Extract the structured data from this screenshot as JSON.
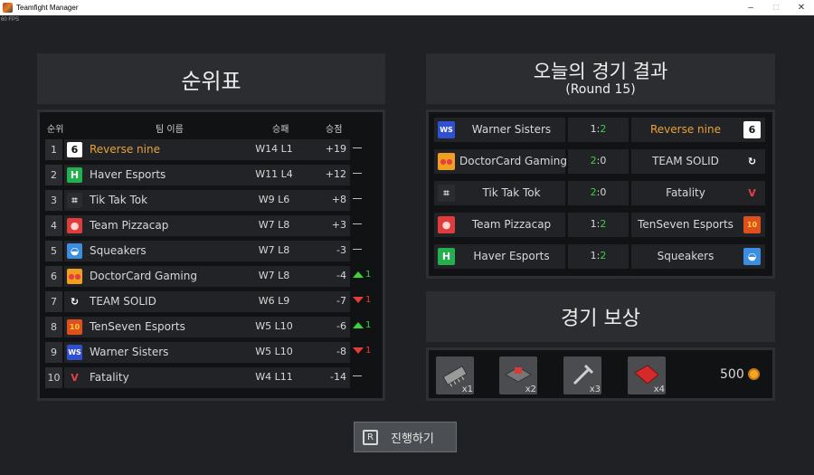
{
  "window": {
    "title": "Teamfight Manager",
    "fps": "60 FPS",
    "minimize": "–",
    "maximize": "□",
    "close": "✕"
  },
  "standings": {
    "title": "순위표",
    "columns": {
      "rank": "순위",
      "team": "팀 이름",
      "record": "승패",
      "points": "승점"
    },
    "rows": [
      {
        "rank": "1",
        "name": "Reverse nine",
        "record": "W14 L1",
        "points": "+19",
        "change": "",
        "dir": "none",
        "highlight": true,
        "logo": "reverse-nine-logo",
        "logo_text": "6",
        "logo_bg": "#ffffff",
        "logo_fg": "#111111"
      },
      {
        "rank": "2",
        "name": "Haver Esports",
        "record": "W11 L4",
        "points": "+12",
        "change": "",
        "dir": "none",
        "highlight": false,
        "logo": "haver-esports-logo",
        "logo_text": "H",
        "logo_bg": "#22b14c",
        "logo_fg": "#ffffff"
      },
      {
        "rank": "3",
        "name": "Tik Tak Tok",
        "record": "W9 L6",
        "points": "+8",
        "change": "",
        "dir": "none",
        "highlight": false,
        "logo": "tik-tak-tok-logo",
        "logo_text": "⌗",
        "logo_bg": "#2a2c2f",
        "logo_fg": "#dddddd"
      },
      {
        "rank": "4",
        "name": "Team Pizzacap",
        "record": "W7 L8",
        "points": "+3",
        "change": "",
        "dir": "none",
        "highlight": false,
        "logo": "team-pizzacap-logo",
        "logo_text": "●",
        "logo_bg": "#e03c3c",
        "logo_fg": "#ffd6d6"
      },
      {
        "rank": "5",
        "name": "Squeakers",
        "record": "W7 L8",
        "points": "-3",
        "change": "",
        "dir": "none",
        "highlight": false,
        "logo": "squeakers-logo",
        "logo_text": "◒",
        "logo_bg": "#3c8fe0",
        "logo_fg": "#ffffff"
      },
      {
        "rank": "6",
        "name": "DoctorCard Gaming",
        "record": "W7 L8",
        "points": "-4",
        "change": "1",
        "dir": "up",
        "highlight": false,
        "logo": "doctorcard-gaming-logo",
        "logo_text": "●●",
        "logo_bg": "#f0a020",
        "logo_fg": "#e84040"
      },
      {
        "rank": "7",
        "name": "TEAM SOLID",
        "record": "W6 L9",
        "points": "-7",
        "change": "1",
        "dir": "down",
        "highlight": false,
        "logo": "team-solid-logo",
        "logo_text": "↻",
        "logo_bg": "#222326",
        "logo_fg": "#ffffff"
      },
      {
        "rank": "8",
        "name": "TenSeven Esports",
        "record": "W5 L10",
        "points": "-6",
        "change": "1",
        "dir": "up",
        "highlight": false,
        "logo": "tenseven-esports-logo",
        "logo_text": "10",
        "logo_bg": "#e0501c",
        "logo_fg": "#ffd040"
      },
      {
        "rank": "9",
        "name": "Warner Sisters",
        "record": "W5 L10",
        "points": "-8",
        "change": "1",
        "dir": "down",
        "highlight": false,
        "logo": "warner-sisters-logo",
        "logo_text": "WS",
        "logo_bg": "#3050d0",
        "logo_fg": "#ffffff"
      },
      {
        "rank": "10",
        "name": "Fatality",
        "record": "W4 L11",
        "points": "-14",
        "change": "",
        "dir": "none",
        "highlight": false,
        "logo": "fatality-logo",
        "logo_text": "V",
        "logo_bg": "#222326",
        "logo_fg": "#e84040"
      }
    ]
  },
  "results": {
    "title": "오늘의 경기 결과",
    "subtitle": "(Round 15)",
    "matches": [
      {
        "left": "Warner Sisters",
        "left_score": "1",
        "right_score": "2",
        "right": "Reverse nine",
        "winner": "right",
        "left_logo": "warner-sisters-logo",
        "left_logo_text": "WS",
        "left_logo_bg": "#3050d0",
        "left_logo_fg": "#ffffff",
        "right_logo": "reverse-nine-logo",
        "right_logo_text": "6",
        "right_logo_bg": "#ffffff",
        "right_logo_fg": "#111111"
      },
      {
        "left": "DoctorCard Gaming",
        "left_score": "2",
        "right_score": "0",
        "right": "TEAM SOLID",
        "winner": "left",
        "left_logo": "doctorcard-gaming-logo",
        "left_logo_text": "●●",
        "left_logo_bg": "#f0a020",
        "left_logo_fg": "#e84040",
        "right_logo": "team-solid-logo",
        "right_logo_text": "↻",
        "right_logo_bg": "#222326",
        "right_logo_fg": "#ffffff"
      },
      {
        "left": "Tik Tak Tok",
        "left_score": "2",
        "right_score": "0",
        "right": "Fatality",
        "winner": "left",
        "left_logo": "tik-tak-tok-logo",
        "left_logo_text": "⌗",
        "left_logo_bg": "#2a2c2f",
        "left_logo_fg": "#dddddd",
        "right_logo": "fatality-logo",
        "right_logo_text": "V",
        "right_logo_bg": "#222326",
        "right_logo_fg": "#e84040"
      },
      {
        "left": "Team Pizzacap",
        "left_score": "1",
        "right_score": "2",
        "right": "TenSeven Esports",
        "winner": "right",
        "left_logo": "team-pizzacap-logo",
        "left_logo_text": "●",
        "left_logo_bg": "#e03c3c",
        "left_logo_fg": "#ffd6d6",
        "right_logo": "tenseven-esports-logo",
        "right_logo_text": "10",
        "right_logo_bg": "#e0501c",
        "right_logo_fg": "#ffd040"
      },
      {
        "left": "Haver Esports",
        "left_score": "1",
        "right_score": "2",
        "right": "Squeakers",
        "winner": "right",
        "left_logo": "haver-esports-logo",
        "left_logo_text": "H",
        "left_logo_bg": "#22b14c",
        "left_logo_fg": "#ffffff",
        "right_logo": "squeakers-logo",
        "right_logo_text": "◒",
        "right_logo_bg": "#3c8fe0",
        "right_logo_fg": "#ffffff"
      }
    ]
  },
  "rewards": {
    "title": "경기 보상",
    "items": [
      {
        "icon": "microchip-icon",
        "count": "x1"
      },
      {
        "icon": "keyboard-switch-icon",
        "count": "x2"
      },
      {
        "icon": "wrench-icon",
        "count": "x3"
      },
      {
        "icon": "red-cloth-icon",
        "count": "x4"
      }
    ],
    "gold": "500",
    "gold_icon": "coin-icon"
  },
  "proceed": {
    "key": "R",
    "label": "진행하기"
  },
  "colors": {
    "highlight": "#e8a23a",
    "win_score": "#3bd23b",
    "up": "#3bd23b",
    "down": "#e43b3b",
    "background": "#1f2124"
  }
}
